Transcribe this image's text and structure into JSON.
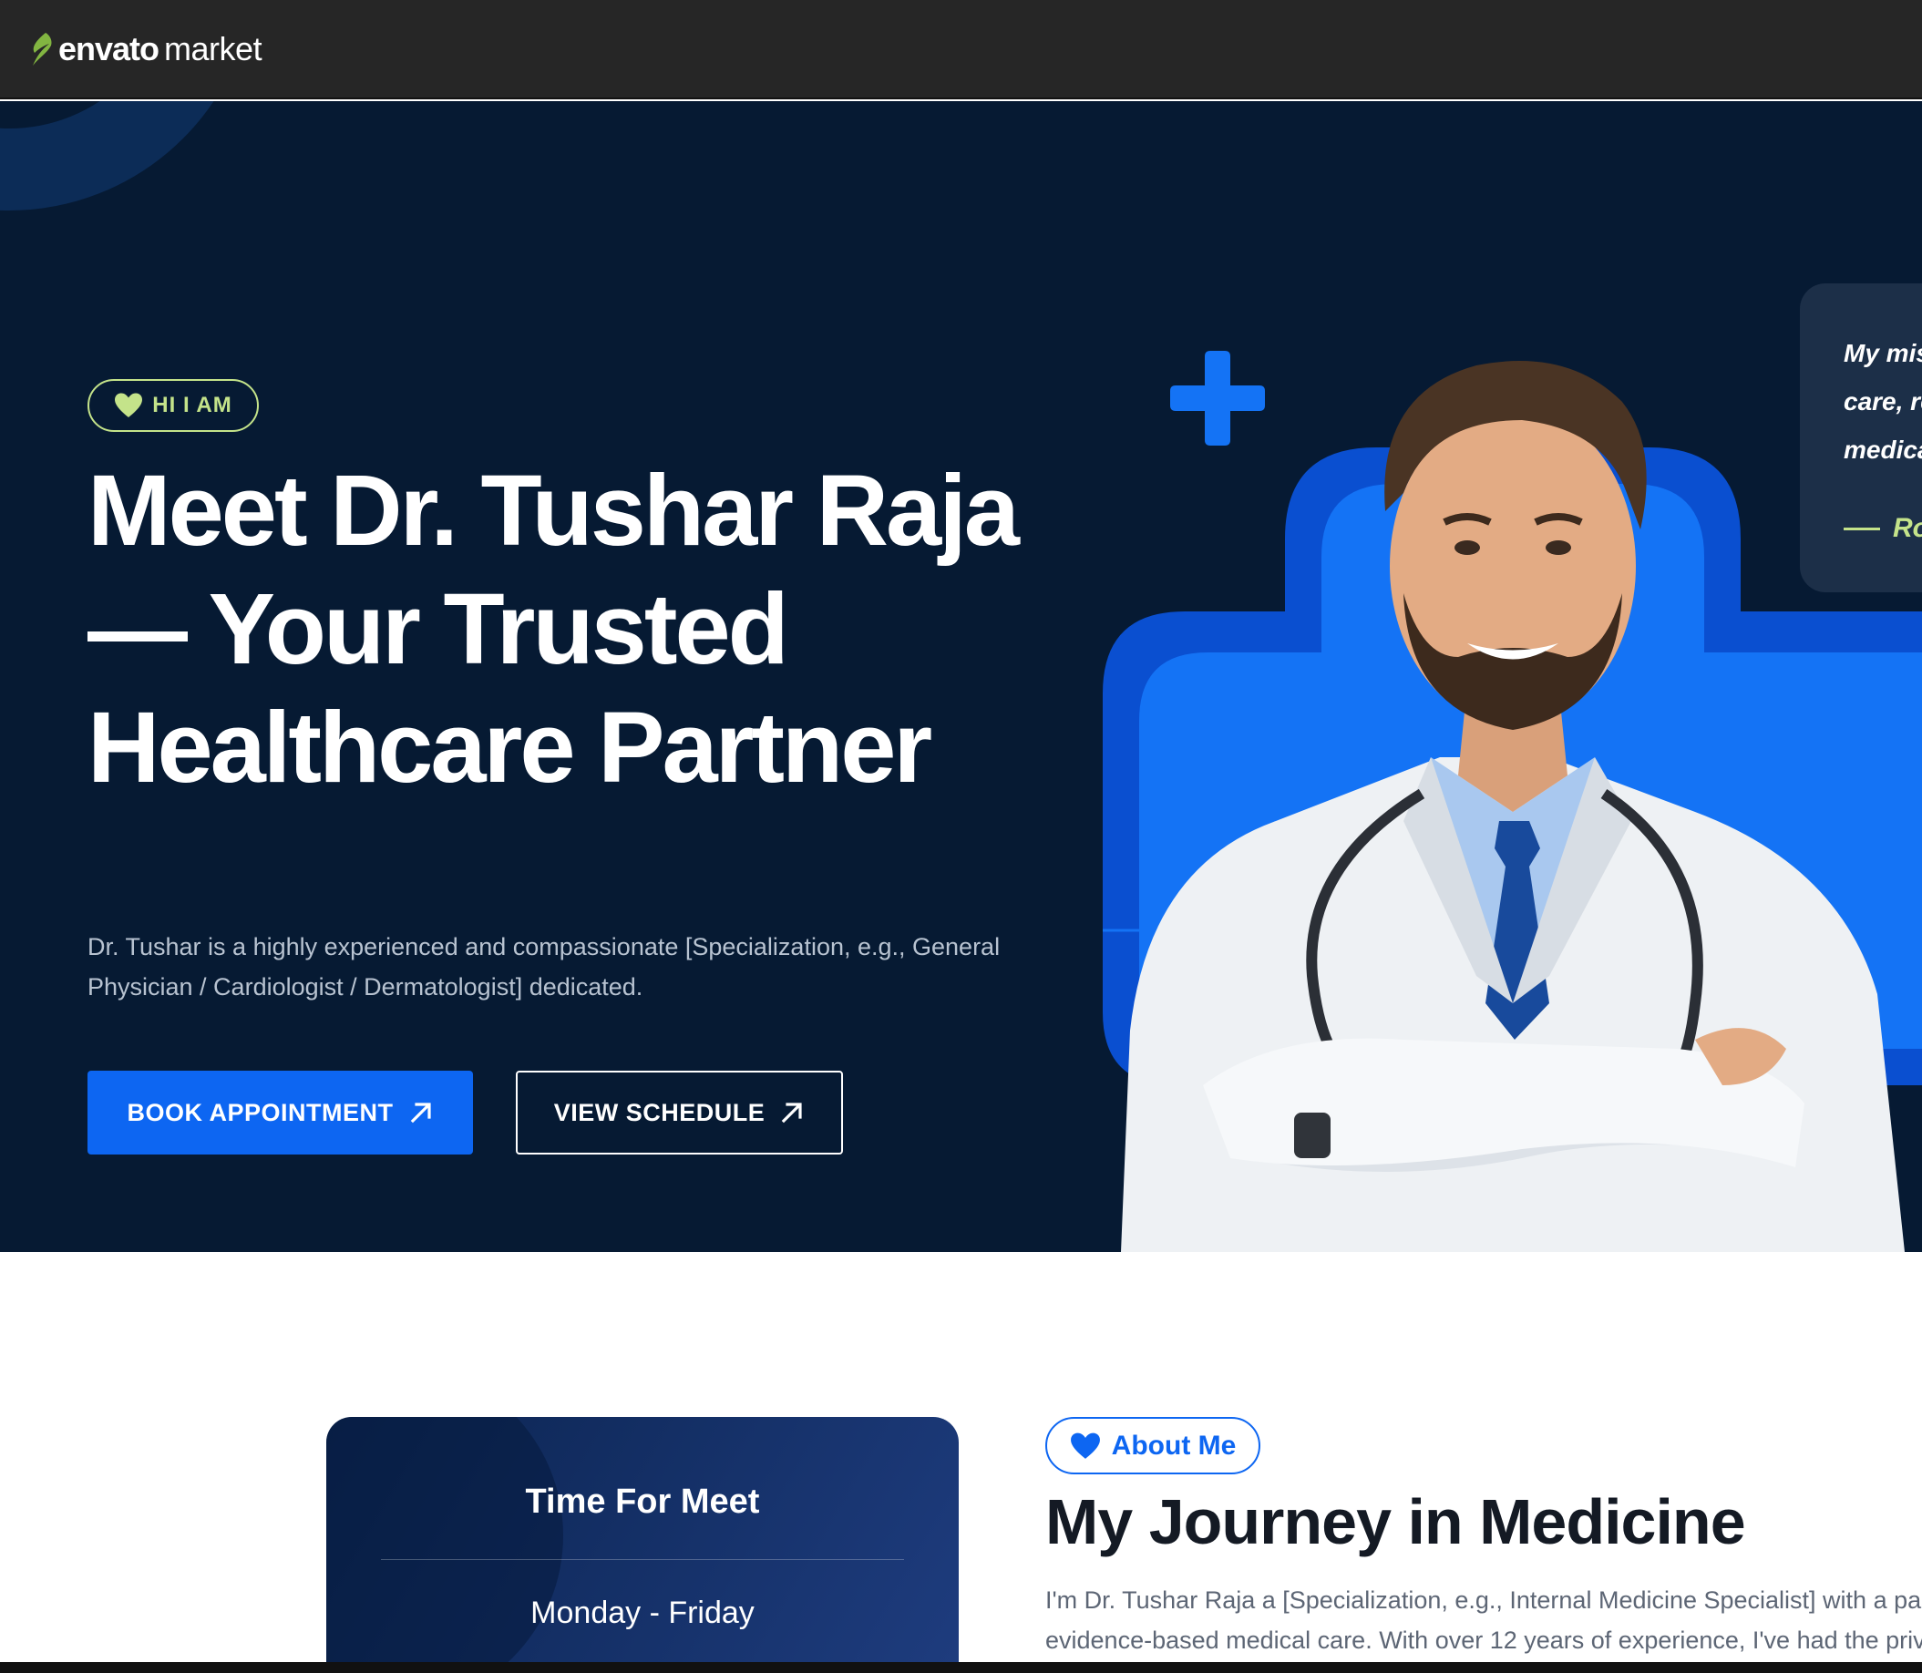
{
  "topbar": {
    "brand_name": "envato",
    "brand_suffix": "market"
  },
  "hero": {
    "badge_label": "HI I AM",
    "title_line1": "Meet Dr. Tushar Raja",
    "title_line2": "— Your Trusted",
    "title_line3": "Healthcare Partner",
    "description": "Dr. Tushar is a highly experienced and compassionate [Specialization, e.g., General Physician / Cardiologist / Dermatologist] dedicated.",
    "primary_button": "BOOK APPOINTMENT",
    "secondary_button": "VIEW SCHEDULE",
    "quote_text": "My mis\ncare, re\nmedica",
    "quote_author": "Ro"
  },
  "schedule": {
    "title": "Time For Meet",
    "days": "Monday - Friday"
  },
  "about": {
    "badge_label": "About Me",
    "title": "My Journey in Medicine",
    "text_line1": "I'm Dr. Tushar Raja a [Specialization, e.g., Internal Medicine Specialist] with a pas",
    "text_line2": "evidence-based medical care. With over 12 years of experience, I've had the priv"
  },
  "colors": {
    "hero_bg": "#061a33",
    "accent_blue": "#0d66f2",
    "accent_lime": "#c4e38a",
    "topbar_bg": "#262626"
  },
  "icons": [
    "envato-leaf-icon",
    "heart-icon",
    "arrow-up-right-icon",
    "plus-icon",
    "heart-icon"
  ]
}
